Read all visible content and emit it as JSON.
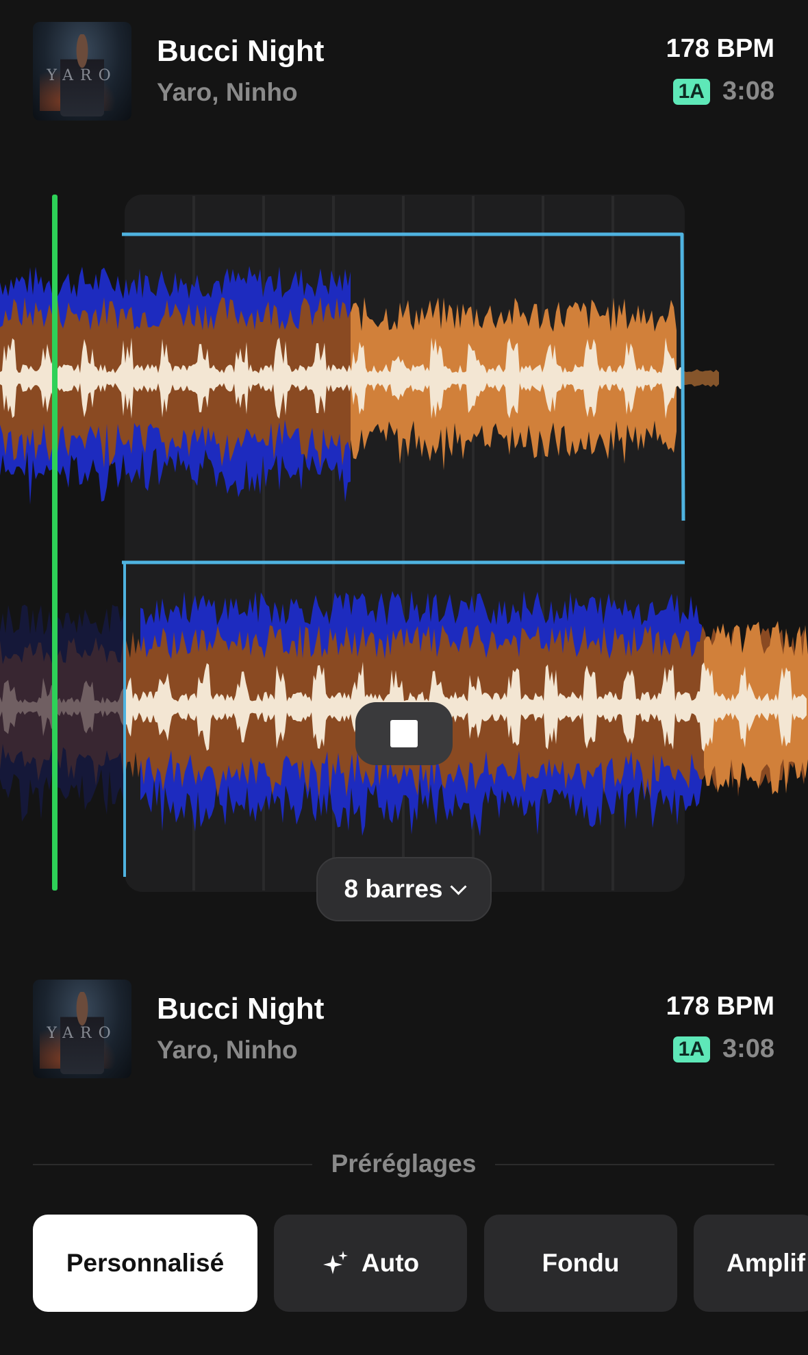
{
  "top_track": {
    "title": "Bucci Night",
    "artist": "Yaro, Ninho",
    "bpm": "178 BPM",
    "key": "1A",
    "duration": "3:08",
    "cover_text": "YARO"
  },
  "bottom_track": {
    "title": "Bucci Night",
    "artist": "Yaro, Ninho",
    "bpm": "178 BPM",
    "key": "1A",
    "duration": "3:08",
    "cover_text": "YARO"
  },
  "transition": {
    "length_label": "8 barres",
    "stop_icon": "stop-icon",
    "dropdown_icon": "chevron-down-icon"
  },
  "presets": {
    "header": "Préréglages",
    "items": [
      {
        "label": "Personnalisé",
        "active": true
      },
      {
        "label": "Auto",
        "icon": "sparkle-icon"
      },
      {
        "label": "Fondu"
      },
      {
        "label": "Amplif"
      }
    ]
  },
  "colors": {
    "background": "#141414",
    "playhead": "#2ed158",
    "automation_line": "#4fb3e0",
    "wave_blue": "#1d2bbf",
    "wave_brown": "#8a4a22",
    "wave_orange": "#d1803a",
    "wave_cream": "#f3e6d3",
    "key_badge": "#5ee8b8"
  }
}
